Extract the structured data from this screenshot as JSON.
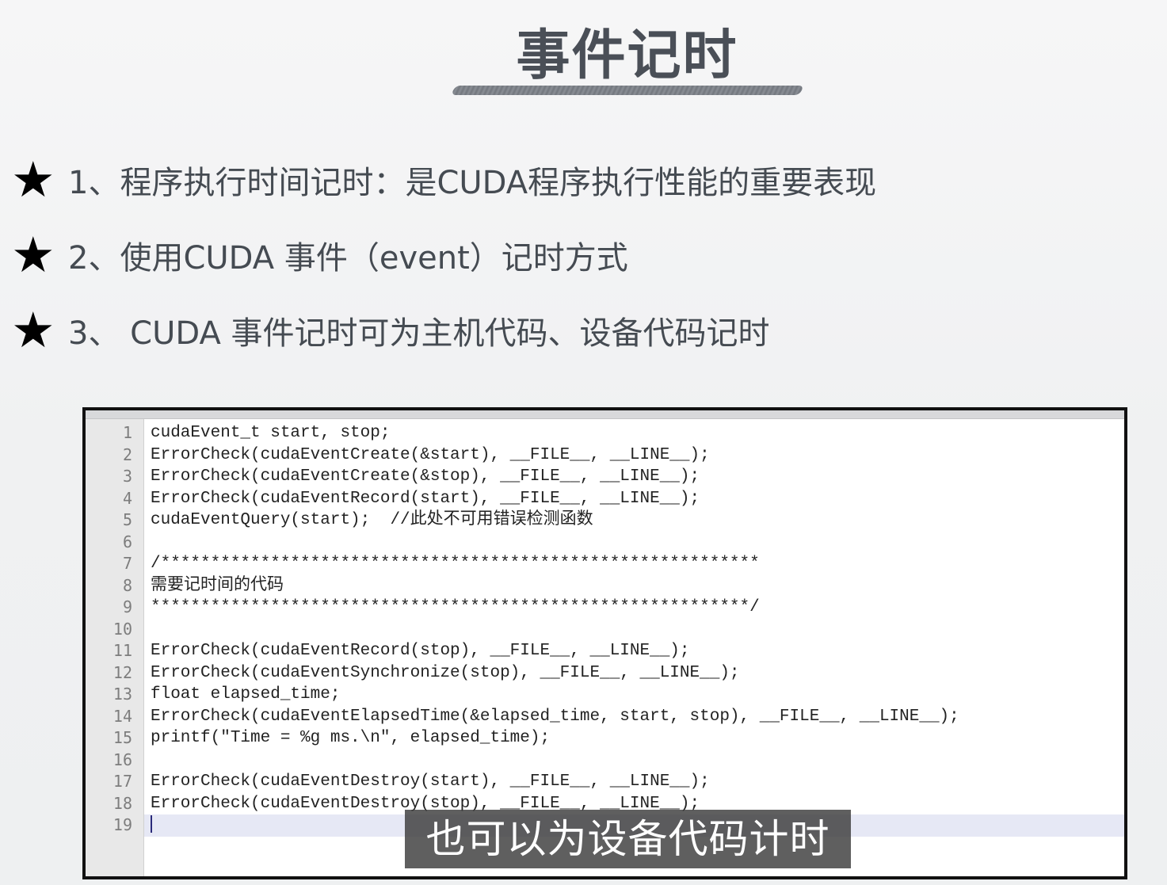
{
  "slide": {
    "title": "事件记时",
    "bullets": [
      {
        "icon": "star-icon",
        "text": "1、程序执行时间记时：是CUDA程序执行性能的重要表现"
      },
      {
        "icon": "star-icon",
        "text": "2、使用CUDA 事件（event）记时方式"
      },
      {
        "icon": "star-icon",
        "text": "3、 CUDA 事件记时可为主机代码、设备代码记时"
      }
    ]
  },
  "editor": {
    "line_numbers": [
      "1",
      "2",
      "3",
      "4",
      "5",
      "6",
      "7",
      "8",
      "9",
      "10",
      "11",
      "12",
      "13",
      "14",
      "15",
      "16",
      "17",
      "18",
      "19"
    ],
    "lines": [
      "cudaEvent_t start, stop;",
      "ErrorCheck(cudaEventCreate(&start), __FILE__, __LINE__);",
      "ErrorCheck(cudaEventCreate(&stop), __FILE__, __LINE__);",
      "ErrorCheck(cudaEventRecord(start), __FILE__, __LINE__);",
      "cudaEventQuery(start);  //此处不可用错误检测函数",
      "",
      "/************************************************************",
      "需要记时间的代码",
      "************************************************************/",
      "",
      "ErrorCheck(cudaEventRecord(stop), __FILE__, __LINE__);",
      "ErrorCheck(cudaEventSynchronize(stop), __FILE__, __LINE__);",
      "float elapsed_time;",
      "ErrorCheck(cudaEventElapsedTime(&elapsed_time, start, stop), __FILE__, __LINE__);",
      "printf(\"Time = %g ms.\\n\", elapsed_time);",
      "",
      "ErrorCheck(cudaEventDestroy(start), __FILE__, __LINE__);",
      "ErrorCheck(cudaEventDestroy(stop), __FILE__, __LINE__);",
      ""
    ],
    "current_line": 19
  },
  "caption": {
    "text": "也可以为设备代码计时"
  },
  "colors": {
    "title": "#4a4f57",
    "bullet_text": "#454b52",
    "current_line_bg": "#e6e8f5",
    "caption_bg": "#3c3c3c"
  }
}
